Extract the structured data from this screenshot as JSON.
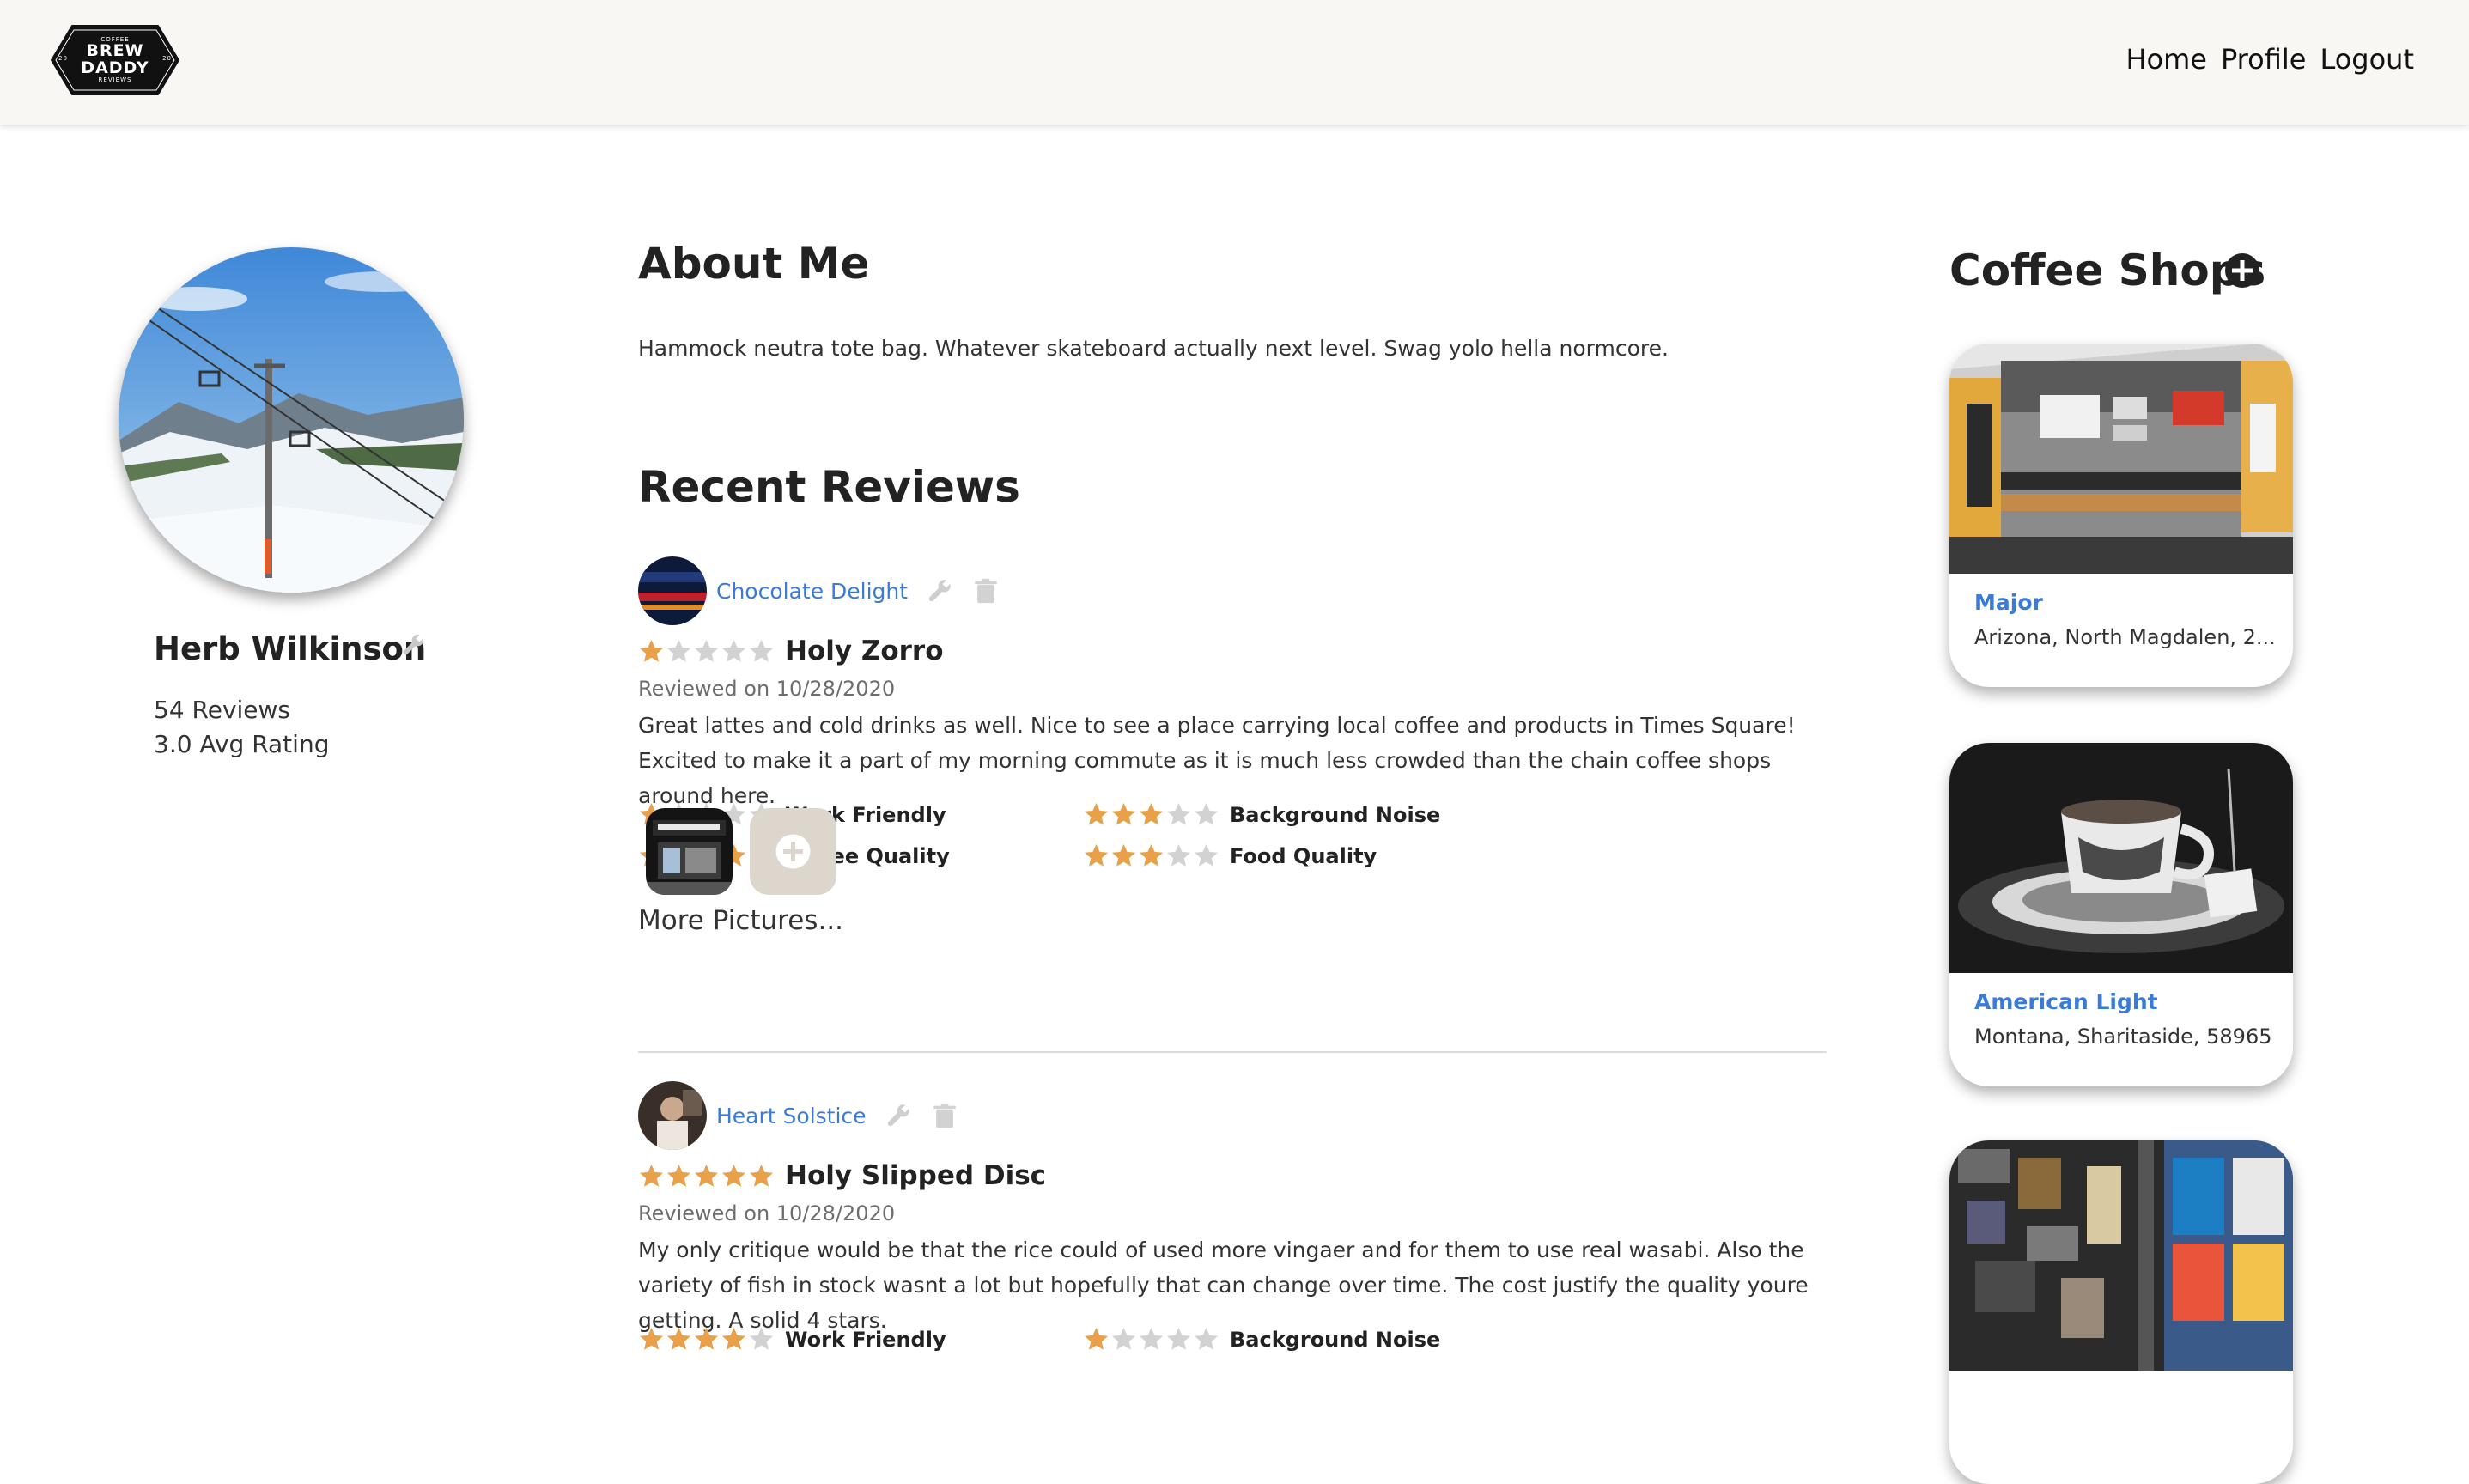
{
  "header": {
    "logo": {
      "top_text": "COFFEE",
      "line1": "BREW",
      "line2": "DADDY",
      "bottom_text": "REVIEWS",
      "left_text": "20",
      "right_text": "20"
    },
    "nav": [
      "Home",
      "Profile",
      "Logout"
    ]
  },
  "profile": {
    "name": "Herb Wilkinson",
    "reviews_count": "54 Reviews",
    "avg_rating": "3.0 Avg Rating",
    "avatar_icon": "ski-lift-photo",
    "edit_icon": "wrench-icon"
  },
  "about": {
    "title": "About Me",
    "text": "Hammock neutra tote bag. Whatever skateboard actually next level. Swag yolo hella normcore."
  },
  "reviews_section": {
    "title": "Recent Reviews",
    "reviews": [
      {
        "shop": "Chocolate Delight",
        "rating": 1,
        "title": "Holy Zorro",
        "date": "Reviewed on 10/28/2020",
        "body": "Great lattes and cold drinks as well. Nice to see a place carrying local coffee and products in Times Square! Excited to make it a part of my morning commute as it is much less crowded than the chain coffee shops around here.",
        "categories": [
          {
            "label": "Work Friendly",
            "rating": 1
          },
          {
            "label": "Background Noise",
            "rating": 3
          },
          {
            "label": "Coffee Quality",
            "rating": 4
          },
          {
            "label": "Food Quality",
            "rating": 3
          }
        ],
        "more_pictures": "More Pictures..."
      },
      {
        "shop": "Heart Solstice",
        "rating": 5,
        "title": "Holy Slipped Disc",
        "date": "Reviewed on 10/28/2020",
        "body": "My only critique would be that the rice could of used more vingaer and for them to use real wasabi. Also the variety of fish in stock wasnt a lot but hopefully that can change over time. The cost justify the quality youre getting. A solid 4 stars.",
        "categories": [
          {
            "label": "Work Friendly",
            "rating": 4
          },
          {
            "label": "Background Noise",
            "rating": 1
          }
        ]
      }
    ]
  },
  "coffee_shops": {
    "title": "Coffee Shops",
    "shops": [
      {
        "name": "Major",
        "location": "Arizona, North Magdalen, 2..."
      },
      {
        "name": "American Light",
        "location": "Montana, Sharitaside, 58965"
      },
      {
        "name": "",
        "location": ""
      }
    ]
  },
  "colors": {
    "accent_link": "#3b7bd8",
    "star_filled": "#e8a04a",
    "star_empty": "#d2d2d2",
    "header_bg": "#f9f7f4"
  }
}
